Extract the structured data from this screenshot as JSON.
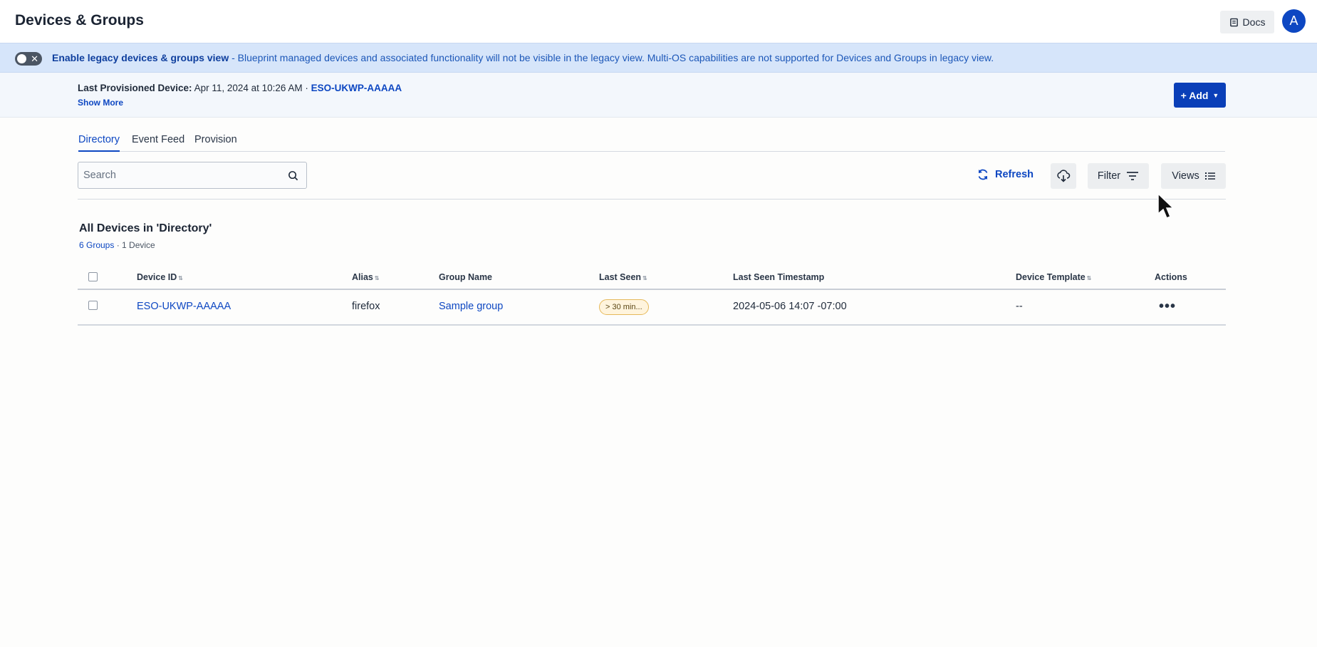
{
  "header": {
    "title": "Devices & Groups",
    "docs_label": "Docs",
    "avatar_initial": "A"
  },
  "banner": {
    "toggle_state": "off",
    "bold_text": "Enable legacy devices & groups view",
    "text": " - Blueprint managed devices and associated functionality will not be visible in the legacy view. Multi-OS capabilities are not supported for Devices and Groups in legacy view."
  },
  "provision": {
    "label": "Last Provisioned Device:",
    "date": " Apr 11, 2024 at 10:26 AM · ",
    "device_link": "ESO-UKWP-AAAAA",
    "show_more": "Show More",
    "add_button": "+ Add"
  },
  "tabs": [
    {
      "label": "Directory",
      "active": true
    },
    {
      "label": "Event Feed",
      "active": false
    },
    {
      "label": "Provision",
      "active": false
    }
  ],
  "toolbar": {
    "search_placeholder": "Search",
    "refresh_label": "Refresh",
    "filter_label": "Filter",
    "views_label": "Views"
  },
  "section": {
    "title": "All Devices in 'Directory'",
    "groups_link": "6 Groups",
    "separator": " · ",
    "device_count": "1 Device"
  },
  "table": {
    "columns": [
      "Device ID",
      "Alias",
      "Group Name",
      "Last Seen",
      "Last Seen Timestamp",
      "Device Template",
      "Actions"
    ],
    "rows": [
      {
        "device_id": "ESO-UKWP-AAAAA",
        "alias": "firefox",
        "group_name": "Sample group",
        "last_seen": "> 30 min...",
        "timestamp": "2024-05-06 14:07 -07:00",
        "template": "--",
        "actions": "•••"
      }
    ]
  },
  "colors": {
    "primary": "#0d47c2",
    "banner_bg": "#d6e5fa",
    "badge_bg": "#fff4dd"
  }
}
